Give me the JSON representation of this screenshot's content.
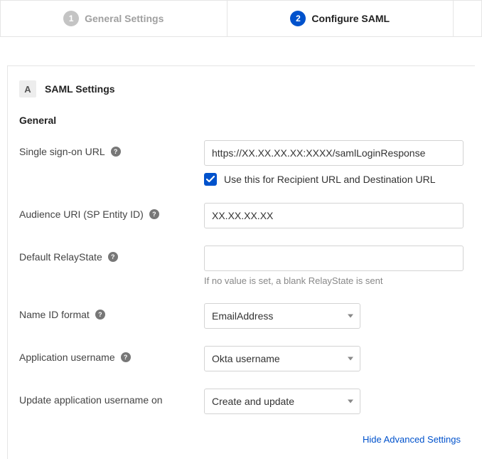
{
  "tabs": {
    "step1_num": "1",
    "step1_label": "General Settings",
    "step2_num": "2",
    "step2_label": "Configure SAML"
  },
  "section": {
    "badge": "A",
    "title": "SAML Settings"
  },
  "heading_general": "General",
  "labels": {
    "sso_url": "Single sign-on URL",
    "audience": "Audience URI (SP Entity ID)",
    "relaystate": "Default RelayState",
    "nameid": "Name ID format",
    "app_user": "Application username",
    "update_on": "Update application username on"
  },
  "values": {
    "sso_url": "https://XX.XX.XX.XX:XXXX/samlLoginResponse",
    "use_for_recipient": "Use this for Recipient URL and Destination URL",
    "audience": "XX.XX.XX.XX",
    "relaystate": "",
    "nameid": "EmailAddress",
    "app_user": "Okta username",
    "update_on": "Create and update"
  },
  "hints": {
    "relaystate": "If no value is set, a blank RelayState is sent"
  },
  "links": {
    "hide_advanced": "Hide Advanced Settings"
  }
}
